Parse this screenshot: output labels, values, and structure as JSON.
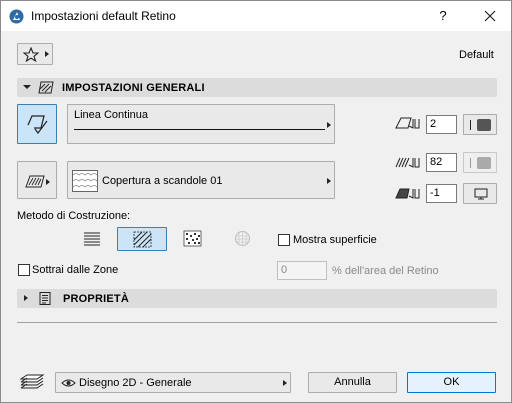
{
  "window": {
    "title": "Impostazioni default Retino",
    "help_label": "?"
  },
  "favorites": {
    "preset_label": "Default"
  },
  "general_section": {
    "title": "IMPOSTAZIONI GENERALI"
  },
  "line_type": {
    "value": "Linea Continua"
  },
  "line_pen": {
    "value": "2"
  },
  "fill": {
    "value": "Copertura a scandole 01"
  },
  "fill_pen": {
    "value": "82"
  },
  "bg_pen": {
    "value": "-1"
  },
  "construction": {
    "label": "Metodo di Costruzione:",
    "show_surface_label": "Mostra superficie"
  },
  "subtract": {
    "label": "Sottrai dalle Zone",
    "value": "0",
    "suffix": "% dell'area del Retino"
  },
  "properties_section": {
    "title": "PROPRIETÀ"
  },
  "footer": {
    "layer_value": "Disegno 2D - Generale",
    "cancel_label": "Annulla",
    "ok_label": "OK"
  },
  "colors": {
    "accent_selected": "#cce4f7",
    "accent_border": "#3c7fb1",
    "header_bg": "#dcdcdc"
  },
  "icons": [
    "archicad-logo-icon",
    "close-icon",
    "star-icon",
    "chevron-down-icon",
    "fill-tool-icon",
    "chevron-right-icon",
    "line-pen-icon",
    "fill-pen-icon",
    "bg-pen-icon",
    "eye-icon",
    "layer-icon",
    "document-icon"
  ]
}
